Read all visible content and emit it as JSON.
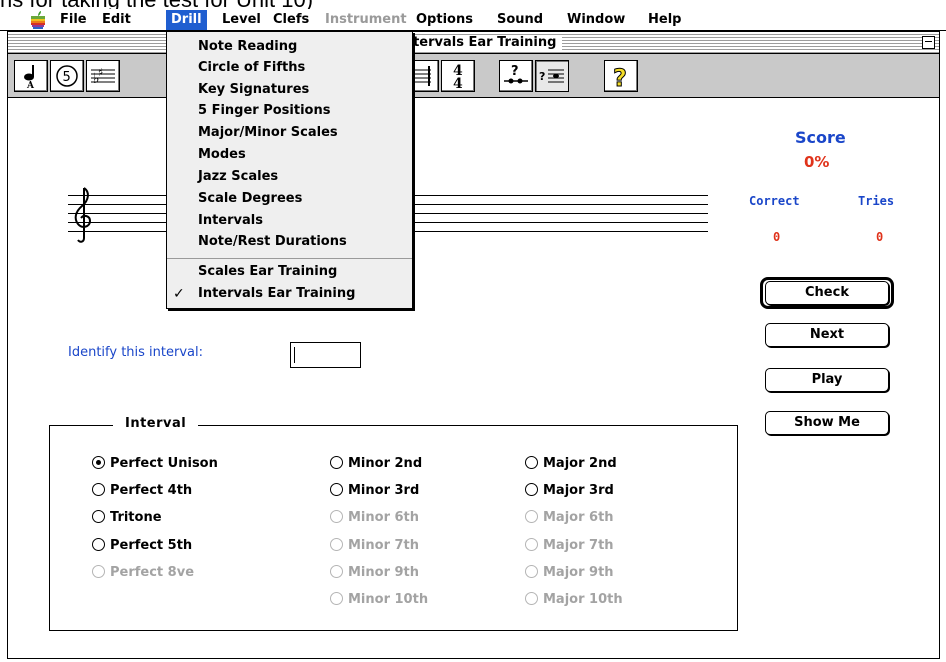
{
  "caption": "ns for taking the test for Unit 10)",
  "menubar": {
    "items": [
      "File",
      "Edit",
      "Drill",
      "Level",
      "Clefs",
      "Instrument",
      "Options",
      "Sound",
      "Window",
      "Help"
    ],
    "active": "Drill",
    "disabled": [
      "Instrument"
    ]
  },
  "window": {
    "title": "Intervals Ear Training"
  },
  "toolbar": {
    "buttons": [
      "note-a-icon",
      "circle-five-icon",
      "key-signature-icon",
      "staff-icon",
      "time-signature-icon",
      "interval-quiz-icon",
      "scale-quiz-icon",
      "help-icon"
    ],
    "time_signature_top": "4",
    "time_signature_bottom": "4",
    "help_glyph": "?"
  },
  "score": {
    "title": "Score",
    "percent": "0%",
    "correct_label": "Correct",
    "tries_label": "Tries",
    "correct": "0",
    "tries": "0"
  },
  "buttons": {
    "check": "Check",
    "next": "Next",
    "play": "Play",
    "show_me": "Show Me"
  },
  "identify": {
    "label": "Identify this interval:",
    "value": ""
  },
  "interval_group": {
    "legend": "Interval",
    "col1": [
      {
        "label": "Perfect Unison",
        "checked": true,
        "disabled": false
      },
      {
        "label": "Perfect 4th",
        "checked": false,
        "disabled": false
      },
      {
        "label": "Tritone",
        "checked": false,
        "disabled": false
      },
      {
        "label": "Perfect 5th",
        "checked": false,
        "disabled": false
      },
      {
        "label": "Perfect 8ve",
        "checked": false,
        "disabled": true
      }
    ],
    "col2": [
      {
        "label": "Minor 2nd",
        "disabled": false
      },
      {
        "label": "Minor 3rd",
        "disabled": false
      },
      {
        "label": "Minor 6th",
        "disabled": true
      },
      {
        "label": "Minor 7th",
        "disabled": true
      },
      {
        "label": "Minor 9th",
        "disabled": true
      },
      {
        "label": "Minor 10th",
        "disabled": true
      }
    ],
    "col3": [
      {
        "label": "Major 2nd",
        "disabled": false
      },
      {
        "label": "Major 3rd",
        "disabled": false
      },
      {
        "label": "Major 6th",
        "disabled": true
      },
      {
        "label": "Major 7th",
        "disabled": true
      },
      {
        "label": "Major 9th",
        "disabled": true
      },
      {
        "label": "Major 10th",
        "disabled": true
      }
    ]
  },
  "drill_menu": {
    "items": [
      "Note Reading",
      "Circle of Fifths",
      "Key Signatures",
      "5 Finger Positions",
      "Major/Minor Scales",
      "Modes",
      "Jazz Scales",
      "Scale Degrees",
      "Intervals",
      "Note/Rest Durations"
    ],
    "items2": [
      "Scales Ear Training",
      "Intervals Ear Training"
    ],
    "checked": "Intervals Ear Training",
    "check_glyph": "✓"
  },
  "colors": {
    "accent_blue": "#1a46c9",
    "score_red": "#e0331b",
    "menu_highlight": "#1f5ed0"
  }
}
